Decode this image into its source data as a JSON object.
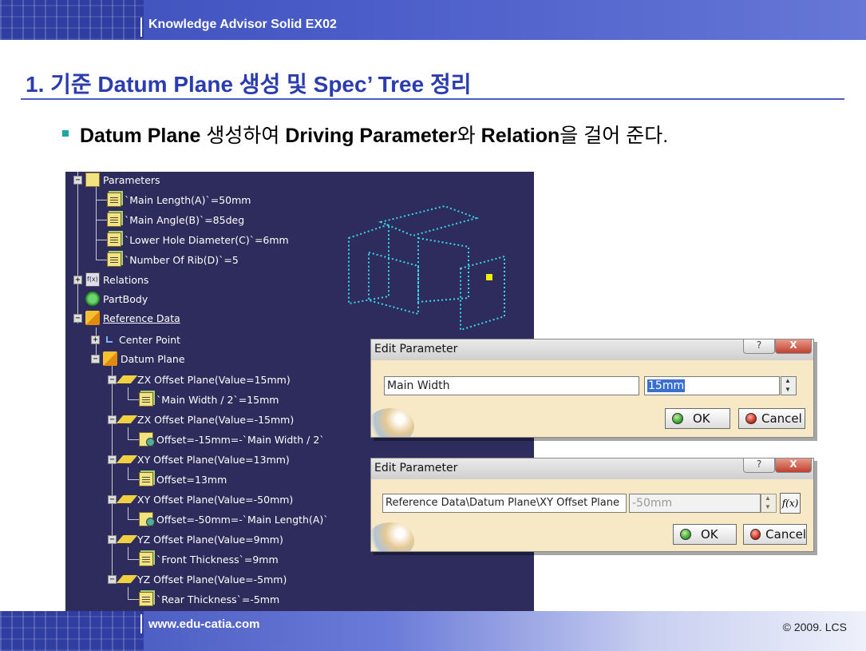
{
  "header": {
    "title": "Knowledge Advisor Solid EX02"
  },
  "footer": {
    "website": "www.edu-catia.com",
    "copyright": "© 2009. LCS"
  },
  "slide": {
    "title": "1. 기준  Datum Plane 생성 및 Spec’ Tree 정리",
    "bullet": {
      "p1": "Datum Plane",
      "p2": " 생성하여 ",
      "p3": "Driving Parameter",
      "p4": "와 ",
      "p5": "Relation",
      "p6": "을 걸어 준다."
    }
  },
  "tree": {
    "parameters": "Parameters",
    "p1": "`Main Length(A)`=50mm",
    "p2": "`Main Angle(B)`=85deg",
    "p3": "`Lower Hole Diameter(C)`=6mm",
    "p4": "`Number Of Rib(D)`=5",
    "relations": "Relations",
    "partbody": "PartBody",
    "reference_data": "Reference Data",
    "center_point": "Center Point",
    "datum_plane": "Datum Plane",
    "zx1": "ZX Offset Plane(Value=15mm)",
    "zx1_f": "`Main Width / 2`=15mm",
    "zx2": "ZX Offset Plane(Value=-15mm)",
    "zx2_f": "Offset=-15mm=-`Main Width / 2`",
    "xy1": "XY Offset Plane(Value=13mm)",
    "xy1_f": "Offset=13mm",
    "xy2": "XY Offset Plane(Value=-50mm)",
    "xy2_f": "Offset=-50mm=-`Main Length(A)`",
    "yz1": "YZ Offset Plane(Value=9mm)",
    "yz1_f": "`Front Thickness`=9mm",
    "yz2": "YZ Offset Plane(Value=-5mm)",
    "yz2_f": "`Rear Thickness`=-5mm"
  },
  "dialog1": {
    "title": "Edit Parameter",
    "help": "?",
    "close": "X",
    "name_value": "Main Width",
    "value": "15mm",
    "ok": "OK",
    "cancel": "Cancel"
  },
  "dialog2": {
    "title": "Edit Parameter",
    "help": "?",
    "close": "X",
    "name_value": "Reference Data\\Datum Plane\\XY Offset Plane",
    "value": "-50mm",
    "fx": "f(x)",
    "ok": "OK",
    "cancel": "Cancel"
  },
  "colors": {
    "accent": "#2a3cb0",
    "tree_bg": "#2e2c5c",
    "dialog_bg": "#f7e8c6",
    "plane_outline": "#38d8e8",
    "point": "#f0f000"
  }
}
